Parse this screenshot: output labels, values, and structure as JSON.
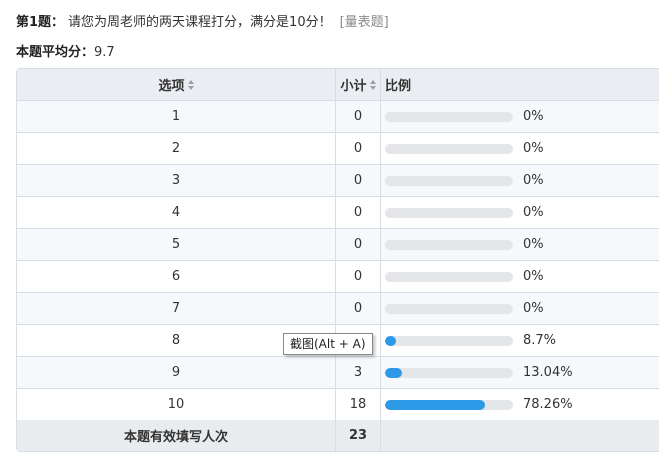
{
  "question": {
    "number": "第1题：",
    "text": "请您为周老师的两天课程打分，满分是10分！",
    "link": "[量表题]"
  },
  "average": {
    "label": "本题平均分：",
    "value": "9.7"
  },
  "table": {
    "headers": {
      "option": "选项",
      "count": "小计",
      "ratio": "比例"
    },
    "rows": [
      {
        "option": "1",
        "count": "0",
        "percent": "0%",
        "fraction": 0
      },
      {
        "option": "2",
        "count": "0",
        "percent": "0%",
        "fraction": 0
      },
      {
        "option": "3",
        "count": "0",
        "percent": "0%",
        "fraction": 0
      },
      {
        "option": "4",
        "count": "0",
        "percent": "0%",
        "fraction": 0
      },
      {
        "option": "5",
        "count": "0",
        "percent": "0%",
        "fraction": 0
      },
      {
        "option": "6",
        "count": "0",
        "percent": "0%",
        "fraction": 0
      },
      {
        "option": "7",
        "count": "0",
        "percent": "0%",
        "fraction": 0
      },
      {
        "option": "8",
        "count": "",
        "percent": "8.7%",
        "fraction": 0.087
      },
      {
        "option": "9",
        "count": "3",
        "percent": "13.04%",
        "fraction": 0.1304
      },
      {
        "option": "10",
        "count": "18",
        "percent": "78.26%",
        "fraction": 0.7826
      }
    ],
    "footer": {
      "label": "本题有效填写人次",
      "total": "23"
    }
  },
  "tooltip": "截图(Alt + A)",
  "colors": {
    "bar": "#2d9ae8",
    "track": "#e4e6ea"
  }
}
